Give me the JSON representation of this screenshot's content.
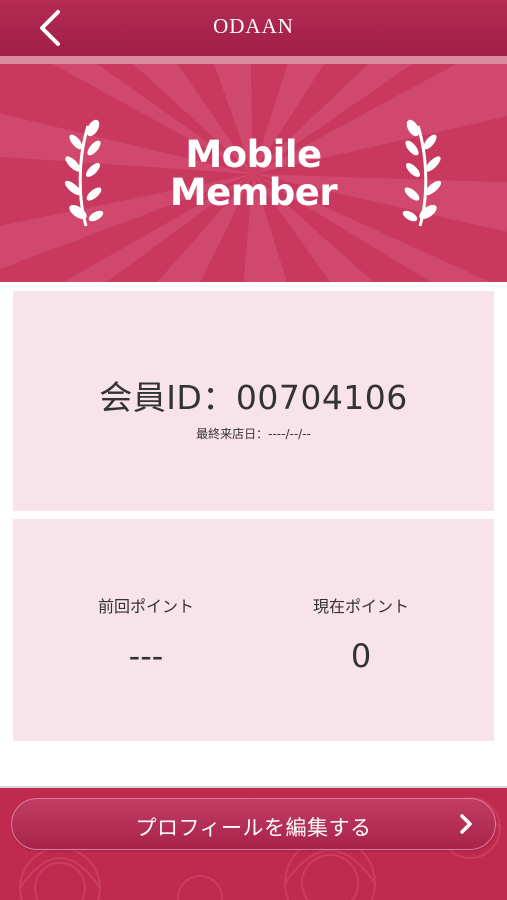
{
  "header": {
    "title": "ODAAN",
    "back_icon": "chevron-left-icon"
  },
  "banner": {
    "line1": "Mobile",
    "line2": "Member",
    "decoration_icon": "laurel-icon"
  },
  "member": {
    "id_text": "会員ID：00704106",
    "last_visit_text": "最終来店日：----/--/--"
  },
  "points": {
    "previous_label": "前回ポイント",
    "previous_value": "---",
    "current_label": "現在ポイント",
    "current_value": "0"
  },
  "footer": {
    "edit_profile_label": "プロフィールを編集する",
    "chevron_icon": "chevron-right-icon"
  },
  "colors": {
    "brand": "#b42b53",
    "banner": "#c9385f",
    "card_bg": "#f7e3e9",
    "text": "#333333"
  }
}
